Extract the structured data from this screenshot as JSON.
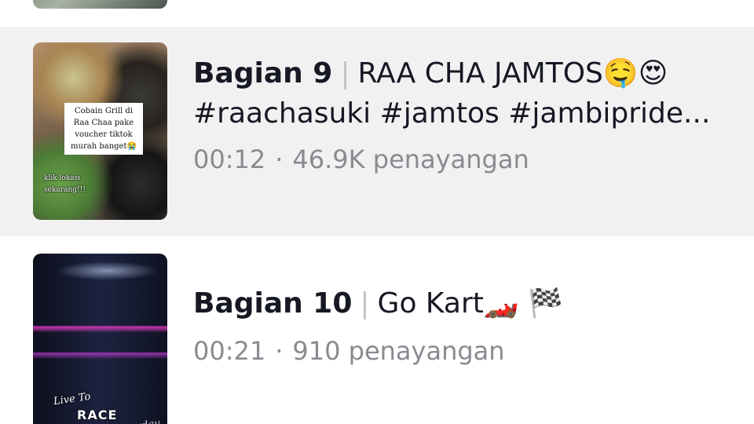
{
  "items": [
    {
      "part": "Bagian 9",
      "separator": "|",
      "title": "RAA CHA JAMTOS🤤😍",
      "hashtags": "#raachasuki #jamtos #jambipride...",
      "duration": "00:12",
      "dot": "·",
      "views": "46.9K penayangan",
      "thumb_caption_lines": [
        "Cobain Grill di",
        "Raa Chaa pake",
        "voucher tiktok",
        "murah banget😭"
      ],
      "thumb_overlay_lines": [
        "klik lokasi",
        "sekarang!!!"
      ],
      "selected": true
    },
    {
      "part": "Bagian 10",
      "separator": "|",
      "title": "Go Kart🏎️ 🏁",
      "duration": "00:21",
      "dot": "·",
      "views": "910 penayangan",
      "thumb_text_live": "Live To",
      "thumb_text_race": "RACE",
      "thumb_text_everyday": "everyday",
      "selected": false
    }
  ],
  "colors": {
    "selected_row_bg": "#f1f1f2",
    "title_text": "#161823",
    "meta_text": "#8a8b91",
    "separator": "#c4c4c8"
  }
}
